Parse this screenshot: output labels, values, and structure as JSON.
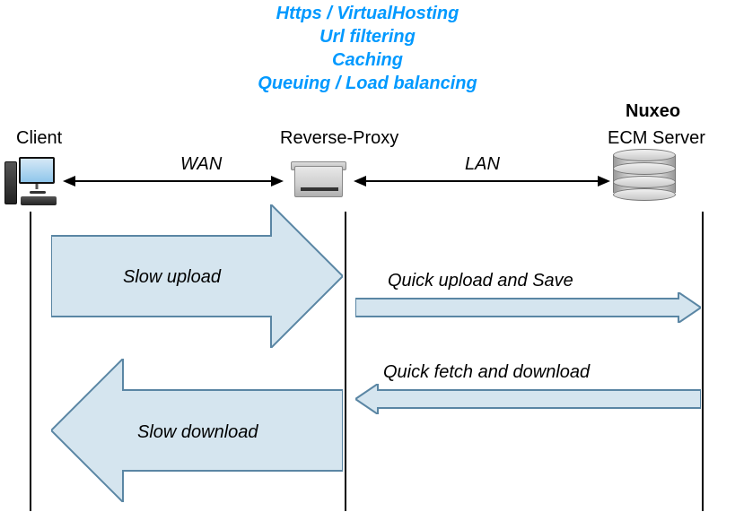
{
  "header": {
    "line1": "Https / VirtualHosting",
    "line2": "Url filtering",
    "line3": "Caching",
    "line4": "Queuing / Load balancing"
  },
  "brand": "Nuxeo",
  "nodes": {
    "client": "Client",
    "proxy": "Reverse-Proxy",
    "server": "ECM Server"
  },
  "edges": {
    "wan": "WAN",
    "lan": "LAN"
  },
  "flows": {
    "slow_upload": "Slow upload",
    "quick_upload": "Quick upload and Save",
    "quick_fetch": "Quick fetch and download",
    "slow_download": "Slow download"
  }
}
